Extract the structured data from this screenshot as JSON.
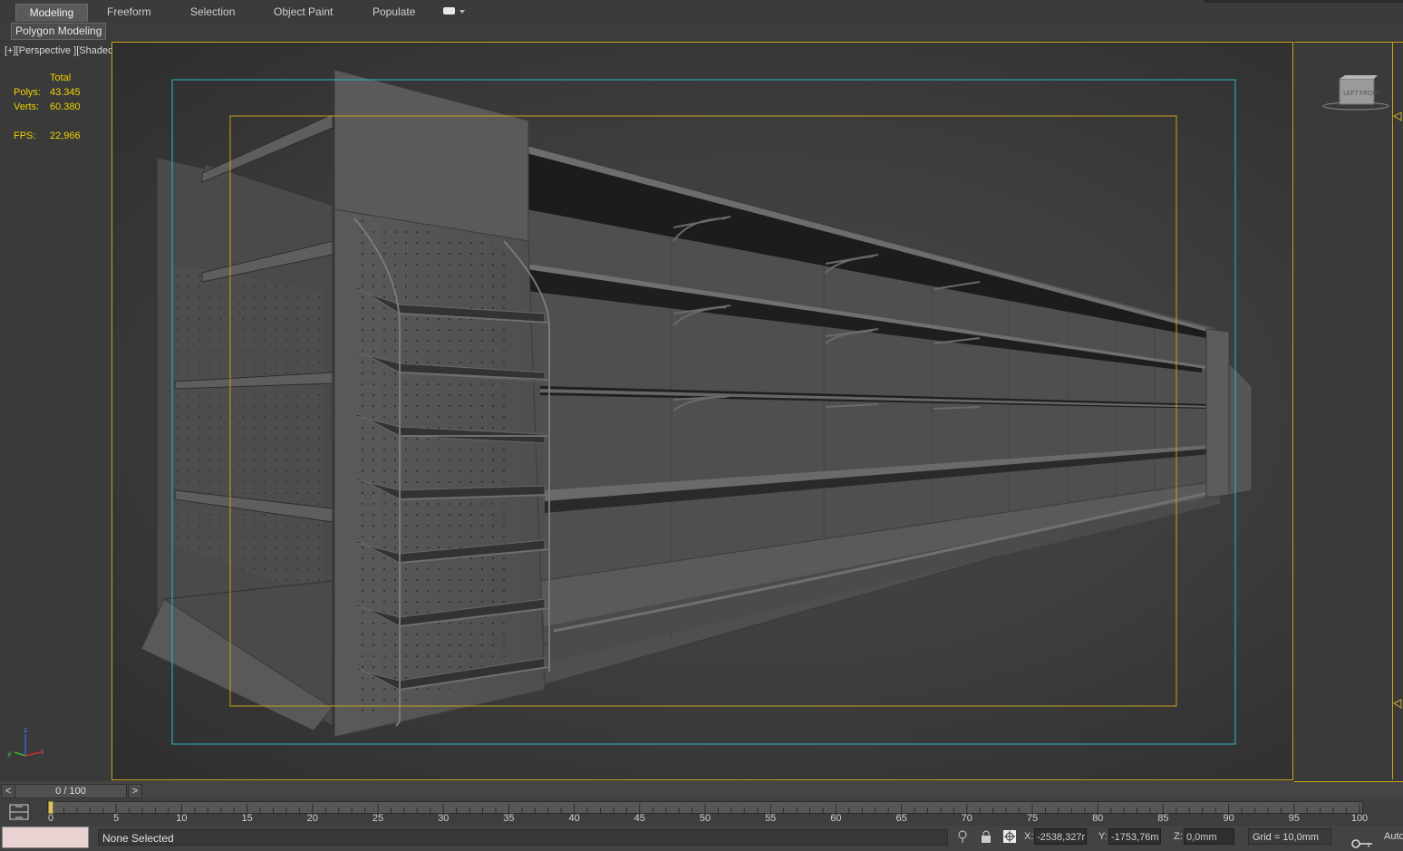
{
  "ribbon": {
    "tabs": [
      {
        "label": "Modeling",
        "active": true
      },
      {
        "label": "Freeform",
        "active": false
      },
      {
        "label": "Selection",
        "active": false
      },
      {
        "label": "Object Paint",
        "active": false
      },
      {
        "label": "Populate",
        "active": false
      }
    ],
    "sub_panel_label": "Polygon Modeling"
  },
  "viewport": {
    "label_plus": "[+]",
    "label_view": "[Perspective ]",
    "label_shading": "[Shaded ]",
    "stats": {
      "total_label": "Total",
      "polys_label": "Polys:",
      "polys_value": "43.345",
      "verts_label": "Verts:",
      "verts_value": "60.380",
      "fps_label": "FPS:",
      "fps_value": "22,966"
    },
    "axis": {
      "x": "x",
      "y": "y",
      "z": "z"
    },
    "border_color": "#c9a21a",
    "safe_frame_colors": {
      "outer": "#2fb7c4",
      "inner": "#c9a21a"
    }
  },
  "timeline": {
    "prev": "<",
    "next": ">",
    "frame_display": "0 / 100",
    "ticks": [
      "0",
      "5",
      "10",
      "15",
      "20",
      "25",
      "30",
      "35",
      "40",
      "45",
      "50",
      "55",
      "60",
      "65",
      "70",
      "75",
      "80",
      "85",
      "90",
      "95",
      "100"
    ]
  },
  "status_bar": {
    "prompt": "None Selected",
    "x_label": "X:",
    "x_value": "-2538,327r",
    "y_label": "Y:",
    "y_value": "-1753,76m",
    "z_label": "Z:",
    "z_value": "0,0mm",
    "grid": "Grid = 10,0mm",
    "auto": "Auto"
  }
}
